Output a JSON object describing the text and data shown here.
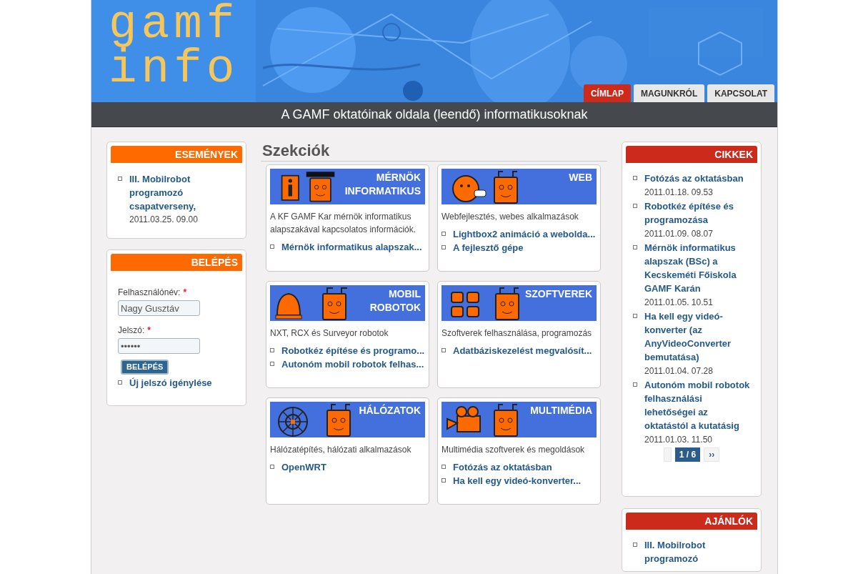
{
  "header": {
    "logo": [
      "gamf",
      "info"
    ],
    "tabs": [
      {
        "label": "CÍMLAP",
        "selected": true
      },
      {
        "label": "MAGUNKRÓL",
        "selected": false
      },
      {
        "label": "KAPCSOLAT",
        "selected": false
      }
    ],
    "slogan": "A GAMF oktatóinak oldala (leendő) informatikusoknak"
  },
  "events": {
    "title": "ESEMÉNYEK",
    "items": [
      {
        "title": "III. Mobilrobot programozó csapatverseny,",
        "date": "2011.03.25. 09.00"
      }
    ]
  },
  "login": {
    "title": "BELÉPÉS",
    "fields": [
      {
        "label": "Felhasználónév:",
        "required_mark": "*",
        "value": "Nagy Gusztáv"
      },
      {
        "label": "Jelszó:",
        "required_mark": "*",
        "value": "••••••"
      }
    ],
    "button": "BELÉPÉS",
    "links": [
      "Új jelszó igénylése"
    ]
  },
  "sections": {
    "title": "Szekciók",
    "cards": [
      {
        "kind": "engineer",
        "title": [
          "MÉRNÖK",
          "INFORMATIKUS"
        ],
        "description": "A KF GAMF Kar mérnök informatikus alapszakával kapcsolatos információk.",
        "links": [
          "Mérnök informatikus alapszak..."
        ]
      },
      {
        "kind": "web",
        "title": [
          "WEB"
        ],
        "description": "Webfejlesztés, webes alkalmazások",
        "links": [
          "Lightbox2 animáció a webolda...",
          "A fejlesztő gépe"
        ]
      },
      {
        "kind": "robots",
        "title": [
          "MOBIL",
          "ROBOTOK"
        ],
        "description": "NXT, RCX és Surveyor robotok",
        "links": [
          "Robotkéz építése és programo...",
          "Autonóm mobil robotok felhas..."
        ]
      },
      {
        "kind": "software",
        "title": [
          "SZOFTVEREK"
        ],
        "description": "Szoftverek felhasználása, programozás",
        "links": [
          "Adatbáziskezelést megvalósít..."
        ]
      },
      {
        "kind": "network",
        "title": [
          "HÁLÓZATOK"
        ],
        "description": "Hálózatépítés, hálózati alkalmazások",
        "links": [
          "OpenWRT"
        ]
      },
      {
        "kind": "multimedia",
        "title": [
          "MULTIMÉDIA"
        ],
        "description": "Multimédia szoftverek és megoldások",
        "links": [
          "Fotózás az oktatásban",
          "Ha kell egy videó-konverter..."
        ]
      }
    ]
  },
  "articles": {
    "title": "CIKKEK",
    "items": [
      {
        "title": "Fotózás az oktatásban",
        "date": "2011.01.18. 09.53"
      },
      {
        "title": "Robotkéz építése és programozása",
        "date": "2011.01.09. 08.07"
      },
      {
        "title": "Mérnök informatikus alapszak (BSc) a Kecskeméti Főiskola GAMF Karán",
        "date": "2011.01.05. 10.51"
      },
      {
        "title": "Ha kell egy videó-konverter (az AnyVideoConverter bemutatása)",
        "date": "2011.01.04. 07.28"
      },
      {
        "title": "Autonóm mobil robotok felhasználási lehetőségei az oktatástól a kutatásig",
        "date": "2011.01.03. 11.50"
      }
    ],
    "pager": [
      {
        "label": "1 / 6",
        "selected": true
      },
      {
        "label": "››",
        "selected": false
      }
    ]
  },
  "recommended": {
    "title": "AJÁNLÓK",
    "items": [
      {
        "title": "III. Mobilrobot programozó"
      }
    ]
  }
}
